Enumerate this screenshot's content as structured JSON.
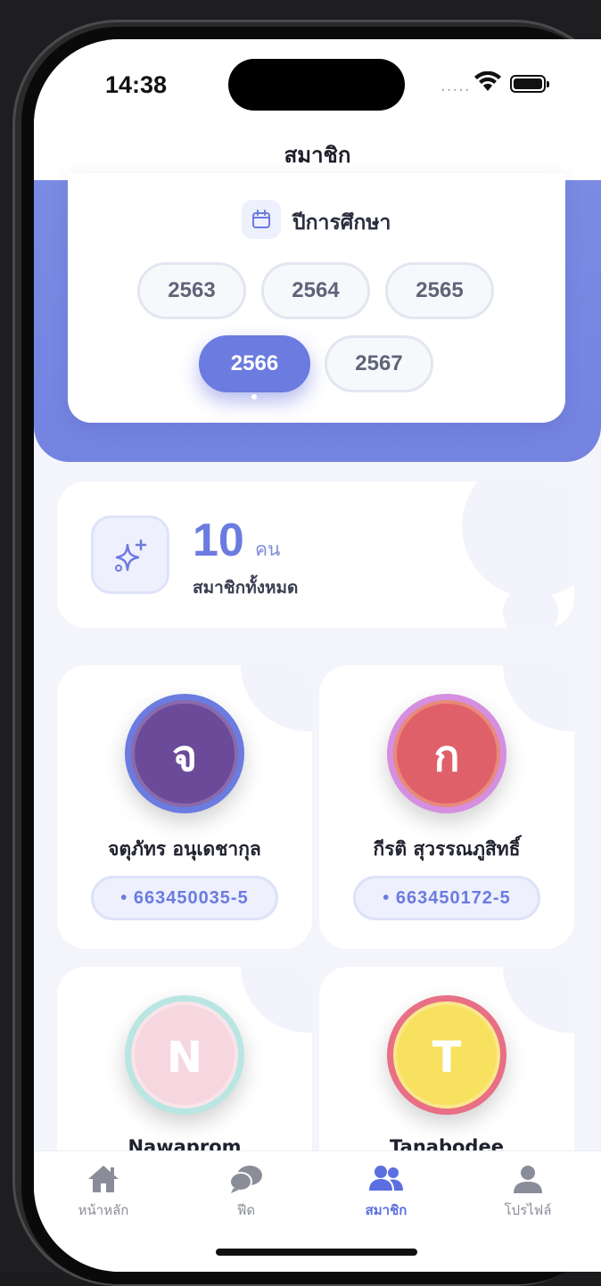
{
  "status": {
    "time": "14:38",
    "signal": "....."
  },
  "nav": {
    "title": "สมาชิก"
  },
  "year_picker": {
    "label": "ปีการศึกษา",
    "years": [
      "2563",
      "2564",
      "2565",
      "2566",
      "2567"
    ],
    "selected": "2566"
  },
  "stats": {
    "count": "10",
    "unit": "คน",
    "label": "สมาชิกทั้งหมด"
  },
  "members": [
    {
      "initial": "จ",
      "name": "จตุภัทร อนุเดชากุล",
      "student_id": "• 663450035-5",
      "color": "#6b4a9a",
      "ring": "#6b7be0"
    },
    {
      "initial": "ก",
      "name": "กีรติ สุวรรณภูสิทธิ์",
      "student_id": "• 663450172-5",
      "color": "#e0606a",
      "ring": "#d68ee0"
    },
    {
      "initial": "N",
      "name": "Nawaprom",
      "color": "#f6d7e0",
      "ring": "#b9e6e3"
    },
    {
      "initial": "T",
      "name": "Tanabodee",
      "color": "#f7e15f",
      "ring": "#e86f85"
    }
  ],
  "tabs": [
    {
      "label": "หน้าหลัก",
      "icon": "home-icon"
    },
    {
      "label": "ฟีด",
      "icon": "chat-icon"
    },
    {
      "label": "สมาชิก",
      "icon": "users-icon",
      "active": true
    },
    {
      "label": "โปรไฟล์",
      "icon": "user-icon"
    }
  ]
}
